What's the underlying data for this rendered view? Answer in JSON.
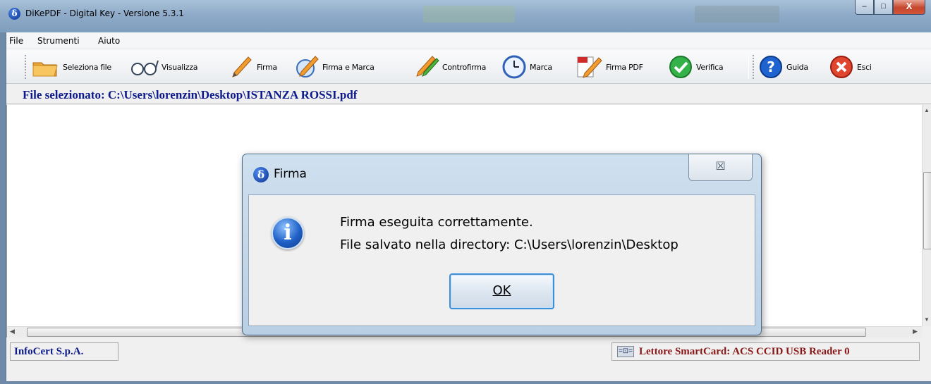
{
  "window": {
    "title": "DiKePDF - Digital Key - Versione 5.3.1",
    "controls": {
      "minimize": "–",
      "maximize": "□",
      "close": "X"
    }
  },
  "menu": {
    "items": [
      "File",
      "Strumenti",
      "Aiuto"
    ]
  },
  "toolbar": {
    "buttons": [
      {
        "label": "Seleziona file",
        "icon": "folder-icon"
      },
      {
        "label": "Visualizza",
        "icon": "glasses-icon"
      },
      {
        "label": "Firma",
        "icon": "pen-icon"
      },
      {
        "label": "Firma e Marca",
        "icon": "pen-clock-icon"
      },
      {
        "label": "Controfirma",
        "icon": "green-pen-icon"
      },
      {
        "label": "Marca",
        "icon": "clock-icon"
      },
      {
        "label": "Firma PDF",
        "icon": "pdf-pen-icon"
      },
      {
        "label": "Verifica",
        "icon": "checkmark-icon"
      },
      {
        "label": "Guida",
        "icon": "help-icon"
      },
      {
        "label": "Esci",
        "icon": "exit-icon"
      }
    ]
  },
  "file_bar": {
    "text": "File selezionato: C:\\Users\\lorenzin\\Desktop\\ISTANZA ROSSI.pdf"
  },
  "status": {
    "left": "InfoCert S.p.A.",
    "reader": "Lettore SmartCard: ACS CCID USB Reader 0"
  },
  "dialog": {
    "title": "Firma",
    "message_line1": "Firma eseguita correttamente.",
    "message_line2": "File salvato nella directory: C:\\Users\\lorenzin\\Desktop",
    "ok_label": "OK",
    "close_glyph": "☒"
  },
  "colors": {
    "title_blue": "#0c1a8c",
    "reader_red": "#8a1616",
    "dialog_frame": "#b9cfe4"
  }
}
